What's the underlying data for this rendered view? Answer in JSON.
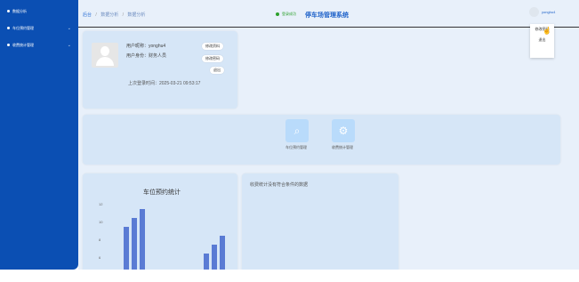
{
  "sidebar": {
    "items": [
      {
        "label": "数据分析"
      },
      {
        "label": "车位预约管理"
      },
      {
        "label": "收费统计管理"
      }
    ]
  },
  "header": {
    "breadcrumb": [
      "后台",
      "数据分析",
      "数据分析"
    ],
    "status": "登录成功",
    "title": "停车场管理系统",
    "username": "yonghu4",
    "dropdown": [
      "修改密码",
      "退出"
    ]
  },
  "user_card": {
    "username_line": "用户昵称：yonghu4",
    "role_line": "用户身份：财务人员",
    "buttons": [
      "修改资料",
      "修改密码",
      "退出"
    ],
    "last_login": "上次登录时间：2025-03-21 09:53:17"
  },
  "features": [
    {
      "label": "车位预约管理",
      "icon": "search-icon"
    },
    {
      "label": "收费统计管理",
      "icon": "settings-icon"
    }
  ],
  "chart_data": {
    "type": "bar",
    "title": "车位预约统计",
    "yticks": [
      "12",
      "10",
      "8",
      "6"
    ],
    "values": [
      10,
      11,
      12,
      0,
      0,
      0,
      0,
      0,
      4,
      5,
      7,
      8,
      9
    ],
    "ylim": [
      4,
      12
    ],
    "color": "#5a7bd4"
  },
  "fee_card": {
    "message": "收费统计没有符合条件的数据"
  }
}
